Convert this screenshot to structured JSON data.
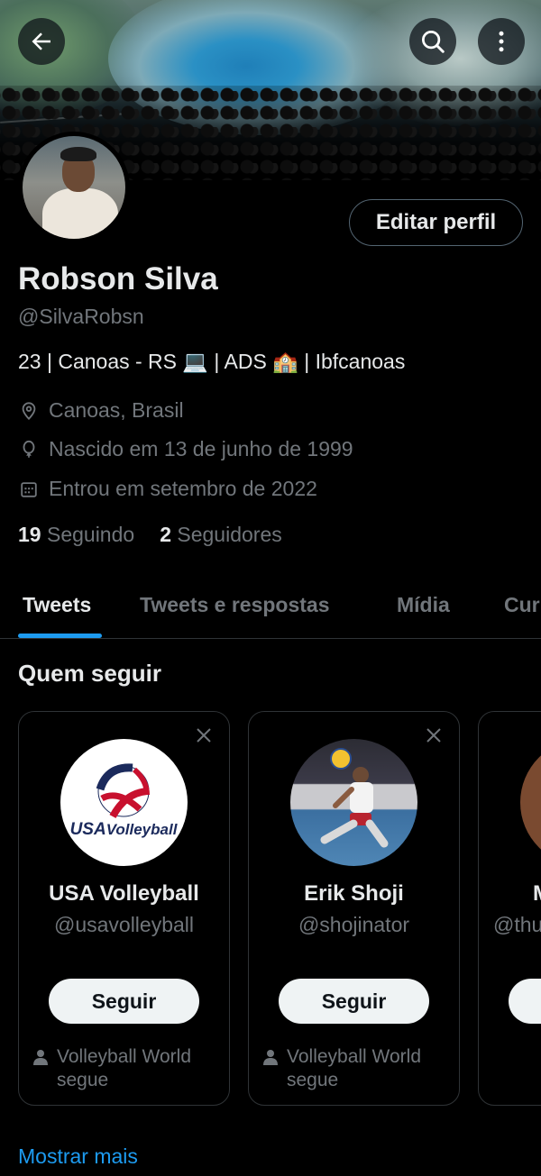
{
  "header": {
    "back_icon": "arrow-left-icon",
    "search_icon": "search-icon",
    "more_icon": "more-vertical-icon"
  },
  "profile": {
    "edit_label": "Editar perfil",
    "name": "Robson Silva",
    "handle": "@SilvaRobsn",
    "bio": "23 | Canoas - RS 💻 | ADS 🏫 | Ibfcanoas",
    "location": "Canoas, Brasil",
    "birth": "Nascido em 13 de junho de 1999",
    "joined": "Entrou em setembro de 2022",
    "following_count": "19",
    "following_label": "Seguindo",
    "followers_count": "2",
    "followers_label": "Seguidores"
  },
  "tabs": [
    {
      "label": "Tweets"
    },
    {
      "label": "Tweets e respostas"
    },
    {
      "label": "Mídia"
    },
    {
      "label": "Cur"
    }
  ],
  "who_to_follow": {
    "title": "Quem seguir",
    "cards": [
      {
        "name": "USA Volleyball",
        "handle": "@usavolleyball",
        "button": "Seguir",
        "social_line1": "Volleyball World",
        "social_line2": "segue"
      },
      {
        "name": "Erik Shoji",
        "handle": "@shojinator",
        "button": "Seguir",
        "social_line1": "Volleyball World",
        "social_line2": "segue"
      },
      {
        "name": "M",
        "handle": "@thu",
        "button": "",
        "social_line1": "",
        "social_line2": ""
      }
    ],
    "show_more": "Mostrar mais"
  },
  "colors": {
    "background": "#000000",
    "primary_text": "#e7e9ea",
    "secondary_text": "#71767b",
    "accent": "#1d9bf0",
    "border": "#2f3336"
  }
}
